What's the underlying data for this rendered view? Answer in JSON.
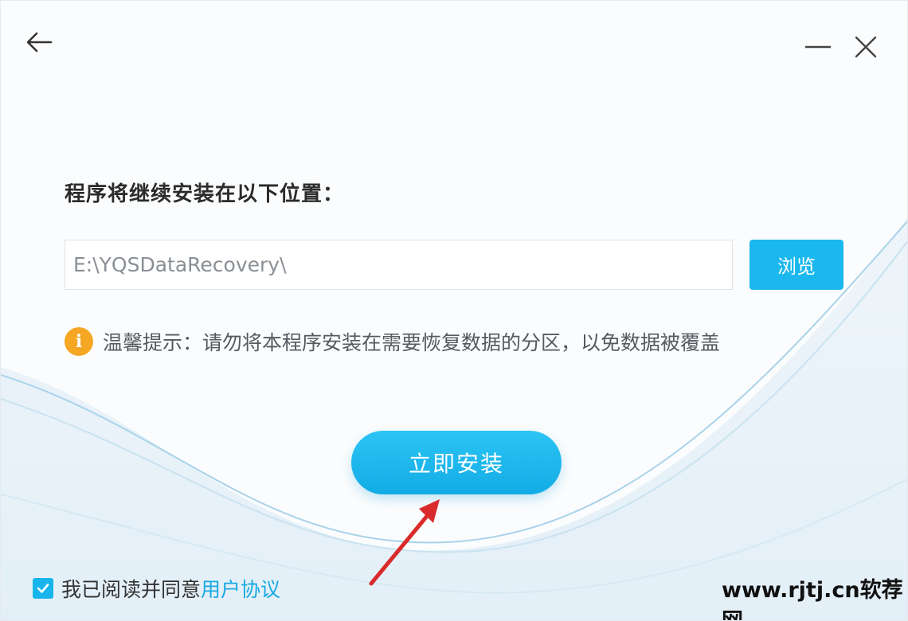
{
  "header": {
    "back_icon": "arrow-left-icon",
    "minimize_icon": "minimize-icon",
    "close_icon": "close-icon"
  },
  "install": {
    "title": "程序将继续安装在以下位置：",
    "path_value": "E:\\YQSDataRecovery\\",
    "browse_label": "浏览",
    "tip_icon": "info-icon",
    "tip_glyph": "i",
    "tip_text": "温馨提示：请勿将本程序安装在需要恢复数据的分区，以免数据被覆盖",
    "install_label": "立即安装"
  },
  "footer": {
    "agree_checked": true,
    "agree_text": "我已阅读并同意",
    "agree_link": "用户协议"
  },
  "watermark": "www.rjtj.cn软荐网",
  "colors": {
    "accent": "#1ab8ee",
    "tip": "#f5a623",
    "annotation_arrow": "#d92b2b"
  }
}
